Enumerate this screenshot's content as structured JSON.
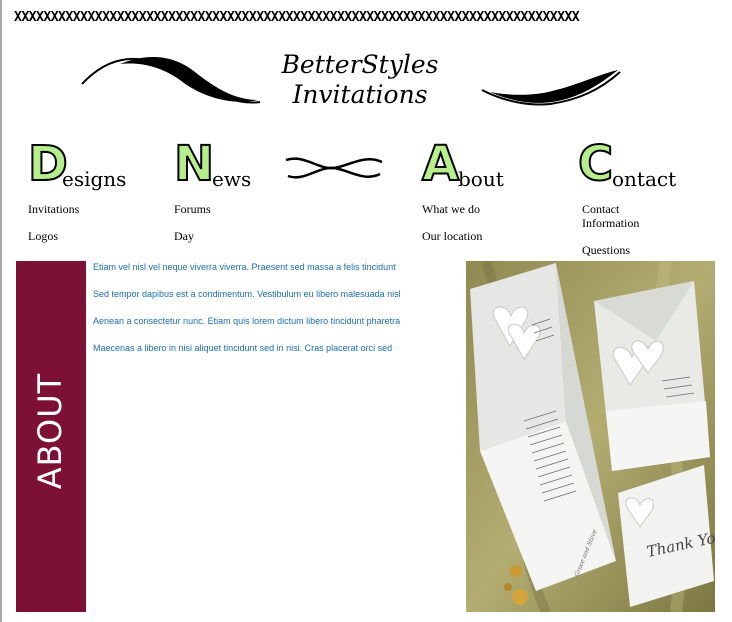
{
  "header": {
    "x_row": "XXXXXXXXXXXXXXXXXXXXXXXXXXXXXXXXXXXXXXXXXXXXXXXXXXXXXXXXXXXXXXXXXXXXXXXXXXXXX",
    "logo_line1": "BetterStyles",
    "logo_line2": "Invitations"
  },
  "nav": [
    {
      "letter": "D",
      "rest": "esigns",
      "links": [
        "Invitations",
        "Logos"
      ]
    },
    {
      "letter": "N",
      "rest": "ews",
      "links": [
        "Forums",
        "Day"
      ]
    },
    {
      "letter": "A",
      "rest": "bout",
      "links": [
        "What we do",
        "Our location"
      ]
    },
    {
      "letter": "C",
      "rest": "ontact",
      "links": [
        "Contact Information",
        "Questions"
      ]
    }
  ],
  "about": {
    "label": "ABOUT",
    "paragraphs": [
      "Etiam vel nisl vel neque viverra viverra. Praesent sed massa a felis tincidunt",
      "Sed tempor dapibus est a condimentum. Vestibulum eu libero malesuada nisl",
      "Aenean a consectetur nunc. Etiam quis lorem dictum libero tincidunt pharetra",
      "Maecenas a libero in nisi aliquet tincidunt sed in nisi. Cras placerat orci sed"
    ]
  },
  "photo": {
    "card_text": "Thank You",
    "names": "Grace and Steve"
  },
  "colors": {
    "letter_fill": "#b7ee8c",
    "about_bar": "#7d1035",
    "paragraph_text": "#1d6db0"
  }
}
